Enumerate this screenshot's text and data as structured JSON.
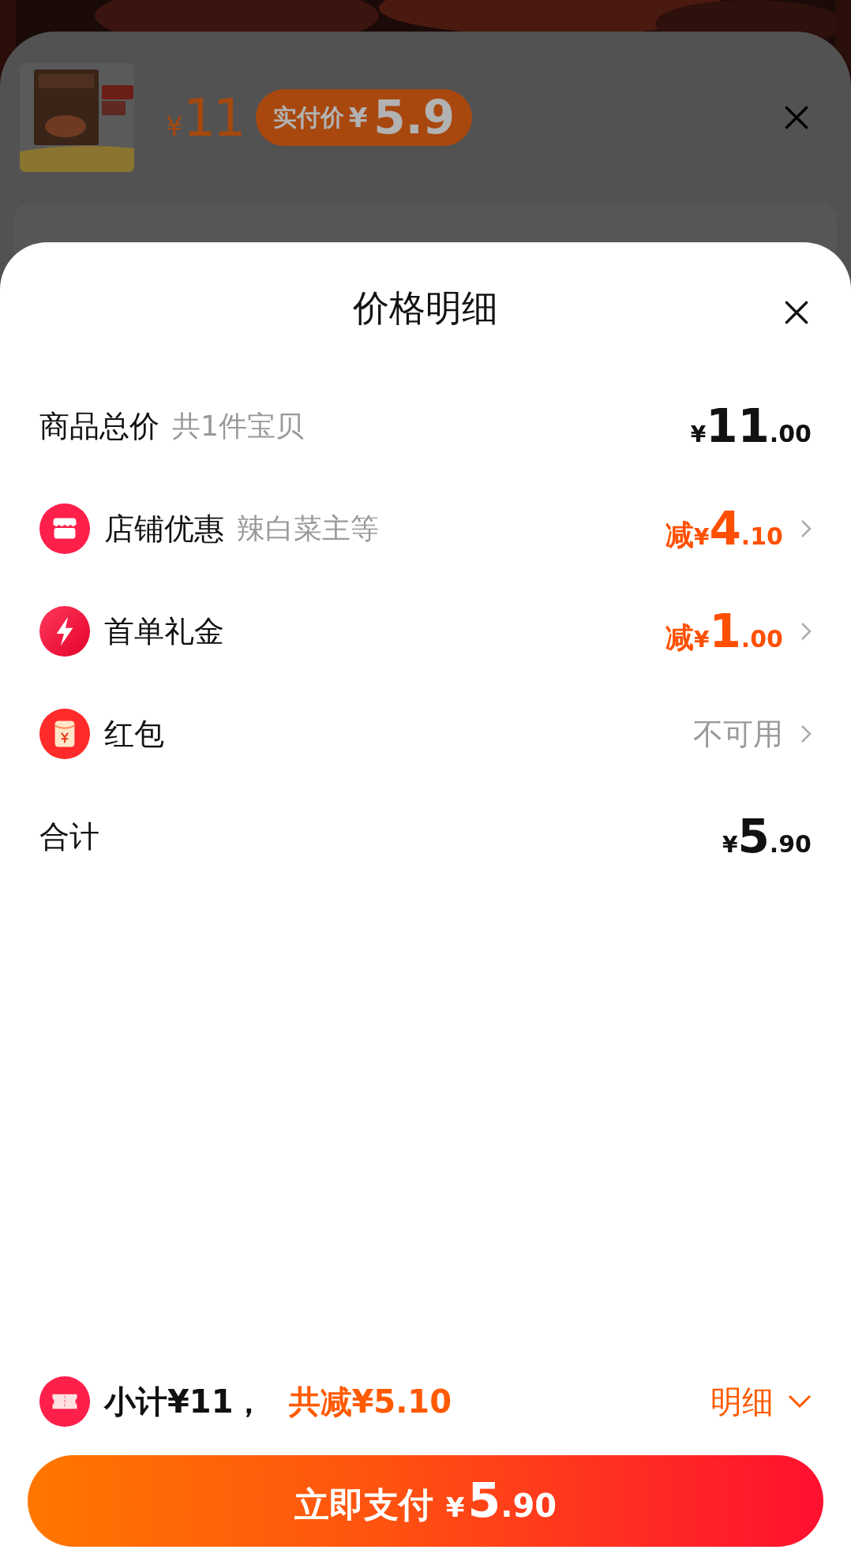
{
  "background_panel": {
    "price": {
      "currency": "¥",
      "integer": "11"
    },
    "actual_price": {
      "label": "实付价",
      "currency": "¥",
      "value": "5.9"
    }
  },
  "sheet": {
    "title": "价格明细"
  },
  "rows": [
    {
      "kind": "plain",
      "label": "商品总价",
      "note": "共1件宝贝",
      "amount": {
        "currency": "¥",
        "integer": "11",
        "decimal": ".00"
      },
      "chevron": false
    },
    {
      "kind": "shop",
      "label": "店铺优惠",
      "note": "辣白菜主等",
      "amount": {
        "prefix": "减",
        "currency": "¥",
        "integer": "4",
        "decimal": ".10"
      },
      "chevron": true
    },
    {
      "kind": "gift",
      "label": "首单礼金",
      "amount": {
        "prefix": "减",
        "currency": "¥",
        "integer": "1",
        "decimal": ".00"
      },
      "chevron": true
    },
    {
      "kind": "packet",
      "label": "红包",
      "status": "不可用",
      "chevron": true
    },
    {
      "kind": "plain",
      "label": "合计",
      "amount": {
        "currency": "¥",
        "integer": "5",
        "decimal": ".90"
      },
      "chevron": false
    }
  ],
  "summary": {
    "subtotal": "小计¥11，",
    "saved": "共减¥5.10",
    "details_toggle": "明细",
    "expanded": false
  },
  "pay_button": {
    "label": "立即支付",
    "currency": "¥",
    "integer": "5",
    "decimal": ".90"
  }
}
